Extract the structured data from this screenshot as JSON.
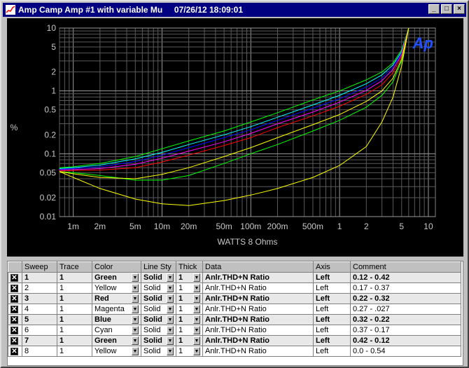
{
  "window": {
    "title": "Amp Camp Amp #1 with variable Mu     07/26/12 18:09:01",
    "controls": {
      "minimize": "_",
      "maximize": "□",
      "close": "×"
    }
  },
  "chart_data": {
    "type": "line",
    "xlabel": "WATTS 8 Ohms",
    "ylabel": "%",
    "xscale": "log",
    "yscale": "log",
    "xlim": [
      0.0007,
      12
    ],
    "ylim": [
      0.01,
      10
    ],
    "grid": true,
    "x_ticks": [
      {
        "v": 0.001,
        "label": "1m"
      },
      {
        "v": 0.002,
        "label": "2m"
      },
      {
        "v": 0.005,
        "label": "5m"
      },
      {
        "v": 0.01,
        "label": "10m"
      },
      {
        "v": 0.02,
        "label": "20m"
      },
      {
        "v": 0.05,
        "label": "50m"
      },
      {
        "v": 0.1,
        "label": "100m"
      },
      {
        "v": 0.2,
        "label": "200m"
      },
      {
        "v": 0.5,
        "label": "500m"
      },
      {
        "v": 1,
        "label": "1"
      },
      {
        "v": 2,
        "label": "2"
      },
      {
        "v": 5,
        "label": "5"
      },
      {
        "v": 10,
        "label": "10"
      }
    ],
    "y_ticks": [
      {
        "v": 10,
        "label": "10"
      },
      {
        "v": 5,
        "label": "5"
      },
      {
        "v": 2,
        "label": "2"
      },
      {
        "v": 1,
        "label": "1"
      },
      {
        "v": 0.5,
        "label": "0.5"
      },
      {
        "v": 0.2,
        "label": "0.2"
      },
      {
        "v": 0.1,
        "label": "0.1"
      },
      {
        "v": 0.05,
        "label": "0.05"
      },
      {
        "v": 0.02,
        "label": "0.02"
      },
      {
        "v": 0.01,
        "label": "0.01"
      }
    ],
    "logo": "Ap",
    "x": [
      0.0007,
      0.001,
      0.002,
      0.005,
      0.01,
      0.02,
      0.05,
      0.1,
      0.2,
      0.5,
      1,
      2,
      3,
      4,
      5,
      6
    ],
    "series": [
      {
        "color": "#00ff00",
        "values": [
          0.06,
          0.062,
          0.07,
          0.09,
          0.12,
          0.16,
          0.23,
          0.32,
          0.45,
          0.72,
          1.0,
          1.5,
          2.0,
          2.8,
          4.5,
          10
        ]
      },
      {
        "color": "#00ffff",
        "values": [
          0.058,
          0.06,
          0.066,
          0.083,
          0.105,
          0.14,
          0.2,
          0.27,
          0.38,
          0.6,
          0.85,
          1.3,
          1.8,
          2.6,
          4.2,
          10
        ]
      },
      {
        "color": "#0000ff",
        "values": [
          0.056,
          0.058,
          0.062,
          0.075,
          0.095,
          0.125,
          0.18,
          0.24,
          0.34,
          0.53,
          0.75,
          1.15,
          1.6,
          2.4,
          4.0,
          10
        ]
      },
      {
        "color": "#ff00ff",
        "values": [
          0.055,
          0.056,
          0.058,
          0.068,
          0.085,
          0.11,
          0.155,
          0.21,
          0.3,
          0.46,
          0.66,
          1.02,
          1.45,
          2.2,
          3.8,
          10
        ]
      },
      {
        "color": "#ff0000",
        "values": [
          0.053,
          0.054,
          0.055,
          0.06,
          0.074,
          0.095,
          0.135,
          0.18,
          0.26,
          0.4,
          0.57,
          0.88,
          1.25,
          1.95,
          3.5,
          10
        ]
      },
      {
        "color": "#00ff00",
        "values": [
          0.052,
          0.05,
          0.045,
          0.038,
          0.038,
          0.045,
          0.07,
          0.1,
          0.14,
          0.23,
          0.34,
          0.55,
          0.85,
          1.4,
          3.0,
          10
        ]
      },
      {
        "color": "#ffff00",
        "values": [
          0.052,
          0.048,
          0.042,
          0.04,
          0.047,
          0.06,
          0.09,
          0.125,
          0.18,
          0.29,
          0.42,
          0.68,
          1.0,
          1.6,
          3.2,
          10
        ]
      },
      {
        "color": "#ffff00",
        "values": [
          0.052,
          0.042,
          0.028,
          0.019,
          0.016,
          0.015,
          0.018,
          0.022,
          0.028,
          0.042,
          0.065,
          0.13,
          0.32,
          0.8,
          2.5,
          10
        ]
      }
    ]
  },
  "table": {
    "headers": [
      "",
      "Sweep",
      "Trace",
      "Color",
      "Line Sty",
      "Thick",
      "Data",
      "Axis",
      "Comment"
    ],
    "rows": [
      {
        "on": true,
        "bold": true,
        "sweep": "1",
        "trace": "1",
        "color": "Green",
        "style": "Solid",
        "thick": "1",
        "data": "Anlr.THD+N Ratio",
        "axis": "Left",
        "comment": "0.12 - 0.42"
      },
      {
        "on": true,
        "bold": false,
        "sweep": "2",
        "trace": "1",
        "color": "Yellow",
        "style": "Solid",
        "thick": "1",
        "data": "Anlr.THD+N Ratio",
        "axis": "Left",
        "comment": "0.17 - 0.37"
      },
      {
        "on": true,
        "bold": true,
        "sweep": "3",
        "trace": "1",
        "color": "Red",
        "style": "Solid",
        "thick": "1",
        "data": "Anlr.THD+N Ratio",
        "axis": "Left",
        "comment": "0.22 - 0.32"
      },
      {
        "on": true,
        "bold": false,
        "sweep": "4",
        "trace": "1",
        "color": "Magenta",
        "style": "Solid",
        "thick": "1",
        "data": "Anlr.THD+N Ratio",
        "axis": "Left",
        "comment": "0.27 - .027"
      },
      {
        "on": true,
        "bold": true,
        "sweep": "5",
        "trace": "1",
        "color": "Blue",
        "style": "Solid",
        "thick": "1",
        "data": "Anlr.THD+N Ratio",
        "axis": "Left",
        "comment": "0.32 - 0.22"
      },
      {
        "on": true,
        "bold": false,
        "sweep": "6",
        "trace": "1",
        "color": "Cyan",
        "style": "Solid",
        "thick": "1",
        "data": "Anlr.THD+N Ratio",
        "axis": "Left",
        "comment": "0.37 - 0.17"
      },
      {
        "on": true,
        "bold": true,
        "sweep": "7",
        "trace": "1",
        "color": "Green",
        "style": "Solid",
        "thick": "1",
        "data": "Anlr.THD+N Ratio",
        "axis": "Left",
        "comment": "0.42 - 0.12"
      },
      {
        "on": true,
        "bold": false,
        "sweep": "8",
        "trace": "1",
        "color": "Yellow",
        "style": "Solid",
        "thick": "1",
        "data": "Anlr.THD+N Ratio",
        "axis": "Left",
        "comment": "0.0 - 0.54"
      }
    ]
  }
}
